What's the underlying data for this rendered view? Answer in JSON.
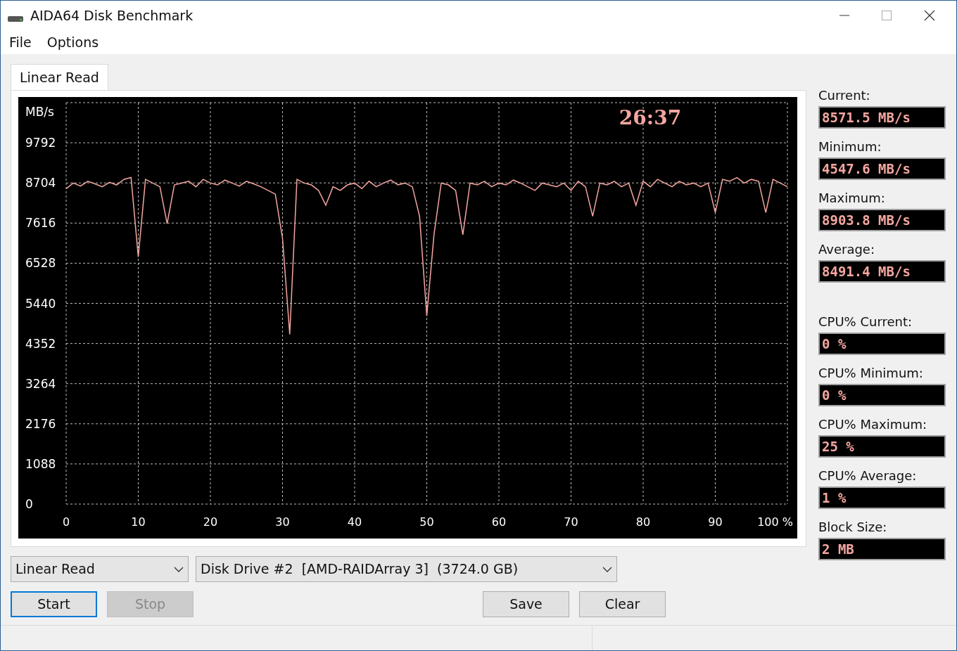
{
  "window": {
    "title": "AIDA64 Disk Benchmark"
  },
  "menu": [
    {
      "label": "File"
    },
    {
      "label": "Options"
    }
  ],
  "tabs": [
    {
      "label": "Linear Read",
      "selected": true
    }
  ],
  "chart": {
    "elapsed": "26:37",
    "chart_data": {
      "type": "line",
      "grid": true,
      "ylabel": "MB/s",
      "xlim": [
        0,
        100
      ],
      "ylim": [
        0,
        10880
      ],
      "xticks": [
        0,
        10,
        20,
        30,
        40,
        50,
        60,
        70,
        80,
        90,
        {
          "value": 100,
          "label": "100 %"
        }
      ],
      "yticks": [
        0,
        1088,
        2176,
        3264,
        4352,
        5440,
        6528,
        7616,
        8704,
        9792
      ],
      "x": [
        0,
        1,
        2,
        3,
        4,
        5,
        6,
        7,
        8,
        9,
        10,
        11,
        12,
        13,
        14,
        15,
        16,
        17,
        18,
        19,
        20,
        21,
        22,
        23,
        24,
        25,
        26,
        27,
        28,
        29,
        30,
        31,
        32,
        33,
        34,
        35,
        36,
        37,
        38,
        39,
        40,
        41,
        42,
        43,
        44,
        45,
        46,
        47,
        48,
        49,
        50,
        51,
        52,
        53,
        54,
        55,
        56,
        57,
        58,
        59,
        60,
        61,
        62,
        63,
        64,
        65,
        66,
        67,
        68,
        69,
        70,
        71,
        72,
        73,
        74,
        75,
        76,
        77,
        78,
        79,
        80,
        81,
        82,
        83,
        84,
        85,
        86,
        87,
        88,
        89,
        90,
        91,
        92,
        93,
        94,
        95,
        96,
        97,
        98,
        99,
        100
      ],
      "series": [
        {
          "color": "#f4a6a0",
          "values": [
            8550,
            8700,
            8620,
            8750,
            8680,
            8600,
            8720,
            8650,
            8800,
            8850,
            6700,
            8800,
            8700,
            8600,
            7600,
            8650,
            8700,
            8750,
            8600,
            8800,
            8700,
            8650,
            8780,
            8700,
            8620,
            8750,
            8680,
            8600,
            8500,
            8400,
            7200,
            4600,
            8800,
            8700,
            8650,
            8500,
            8100,
            8600,
            8500,
            8650,
            8700,
            8550,
            8750,
            8600,
            8700,
            8780,
            8650,
            8700,
            8600,
            7800,
            5100,
            7300,
            8700,
            8650,
            8500,
            7300,
            8700,
            8650,
            8750,
            8600,
            8700,
            8650,
            8780,
            8700,
            8600,
            8500,
            8700,
            8650,
            8600,
            8700,
            8500,
            8750,
            8600,
            7800,
            8700,
            8650,
            8750,
            8600,
            8700,
            8100,
            8750,
            8600,
            8800,
            8700,
            8600,
            8750,
            8650,
            8700,
            8600,
            8700,
            7900,
            8800,
            8750,
            8850,
            8700,
            8800,
            8750,
            7900,
            8800,
            8700,
            8600
          ]
        }
      ]
    }
  },
  "stats": [
    {
      "label": "Current:",
      "value": "8571.5 MB/s"
    },
    {
      "label": "Minimum:",
      "value": "4547.6 MB/s"
    },
    {
      "label": "Maximum:",
      "value": "8903.8 MB/s"
    },
    {
      "label": "Average:",
      "value": "8491.4 MB/s"
    },
    {
      "label": "CPU% Current:",
      "value": "0 %"
    },
    {
      "label": "CPU% Minimum:",
      "value": "0 %"
    },
    {
      "label": "CPU% Maximum:",
      "value": "25 %"
    },
    {
      "label": "CPU% Average:",
      "value": "1 %"
    },
    {
      "label": "Block Size:",
      "value": "2 MB"
    }
  ],
  "test_select": {
    "value": "Linear Read"
  },
  "drive_select": {
    "value": "Disk Drive #2  [AMD-RAIDArray 3]  (3724.0 GB)"
  },
  "buttons": [
    {
      "label": "Start",
      "disabled": false,
      "focused": true
    },
    {
      "label": "Stop",
      "disabled": true,
      "focused": false
    },
    {
      "label": "Save",
      "disabled": false,
      "focused": false
    },
    {
      "label": "Clear",
      "disabled": false,
      "focused": false
    }
  ]
}
